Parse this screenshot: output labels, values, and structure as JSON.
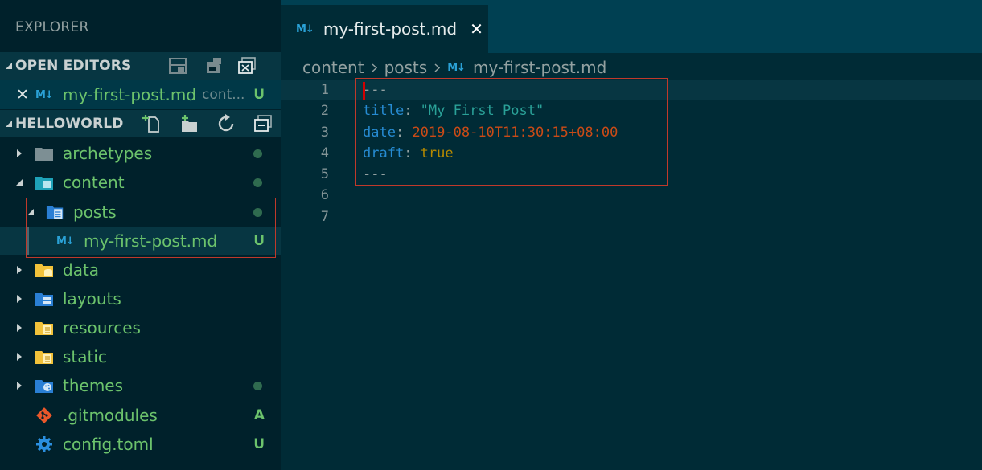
{
  "sidebar": {
    "title": "EXPLORER",
    "open_editors": {
      "title": "OPEN EDITORS",
      "items": [
        {
          "icon": "M↓",
          "name": "my-first-post.md",
          "description": "cont...",
          "status": "U"
        }
      ]
    },
    "workspace": {
      "title": "HELLOWORLD",
      "items": [
        {
          "name": "archetypes",
          "status": "dot"
        },
        {
          "name": "content",
          "status": "dot"
        },
        {
          "name": "posts",
          "status": "dot"
        },
        {
          "name": "my-first-post.md",
          "icon": "M↓",
          "status": "U"
        },
        {
          "name": "data"
        },
        {
          "name": "layouts"
        },
        {
          "name": "resources"
        },
        {
          "name": "static"
        },
        {
          "name": "themes",
          "status": "dot"
        },
        {
          "name": ".gitmodules",
          "status": "A"
        },
        {
          "name": "config.toml",
          "status": "U"
        }
      ]
    }
  },
  "tab": {
    "icon": "M↓",
    "name": "my-first-post.md",
    "close": "✕"
  },
  "breadcrumb": {
    "parts": [
      "content",
      "posts"
    ],
    "icon": "M↓",
    "file": "my-first-post.md"
  },
  "editor": {
    "line_numbers": [
      "1",
      "2",
      "3",
      "4",
      "5",
      "6",
      "7"
    ],
    "lines": [
      {
        "plain": "---"
      },
      {
        "key": "title",
        "sep": ": ",
        "value": "\"My First Post\""
      },
      {
        "key": "date",
        "sep": ": ",
        "value": "2019-08-10T11:30:15+08:00"
      },
      {
        "key": "draft",
        "sep": ": ",
        "value": "true"
      },
      {
        "plain": "---"
      }
    ]
  },
  "colors": {
    "sidebar_bg": "#00212b",
    "editor_bg": "#002b36",
    "git_untracked": "#6cc36c",
    "highlight_box": "#c0392b",
    "yaml_key": "#268bd2",
    "yaml_string": "#2aa198",
    "yaml_date": "#cb4b16",
    "yaml_bool": "#b58900"
  }
}
